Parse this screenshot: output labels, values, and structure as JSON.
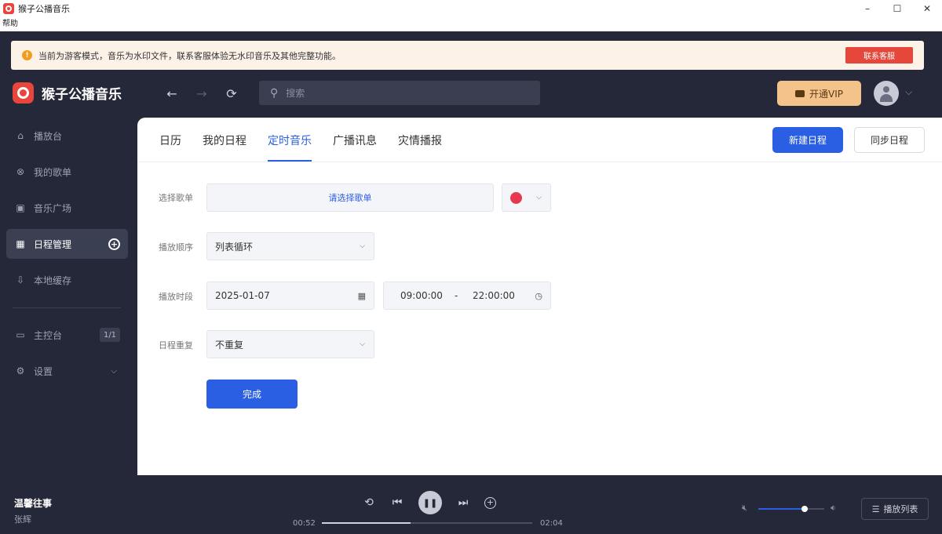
{
  "window": {
    "title": "猴子公播音乐",
    "minimize": "–",
    "maximize": "☐",
    "close": "✕"
  },
  "menubar": {
    "help": "帮助"
  },
  "notice": {
    "text": "当前为游客模式，音乐为水印文件，联系客服体验无水印音乐及其他完整功能。",
    "button": "联系客服",
    "icon": "warning-icon"
  },
  "header": {
    "logo": "猴子公播音乐",
    "back": "←",
    "forward": "→",
    "refresh": "⟳",
    "search_placeholder": "搜索",
    "vip": "开通VIP"
  },
  "sidebar": {
    "items": [
      {
        "label": "播放台",
        "icon": "home-icon",
        "glyph": "⌂"
      },
      {
        "label": "我的歌单",
        "icon": "playlist-icon",
        "glyph": "⊗"
      },
      {
        "label": "音乐广场",
        "icon": "music-square-icon",
        "glyph": "▣"
      },
      {
        "label": "日程管理",
        "icon": "calendar-icon",
        "glyph": "▦"
      },
      {
        "label": "本地缓存",
        "icon": "download-icon",
        "glyph": "⇩"
      },
      {
        "label": "主控台",
        "icon": "monitor-icon",
        "glyph": "▭",
        "badge": "1/1"
      },
      {
        "label": "设置",
        "icon": "gear-icon",
        "glyph": "⚙"
      }
    ]
  },
  "tabs": [
    "日历",
    "我的日程",
    "定时音乐",
    "广播讯息",
    "灾情播报"
  ],
  "active_tab": "定时音乐",
  "actions": {
    "new": "新建日程",
    "sync": "同步日程"
  },
  "form": {
    "playlist_label": "选择歌单",
    "playlist_value": "请选择歌单",
    "color": "#e8384f",
    "order_label": "播放顺序",
    "order_value": "列表循环",
    "period_label": "播放时段",
    "date_value": "2025-01-07",
    "time_start": "09:00:00",
    "time_sep": "-",
    "time_end": "22:00:00",
    "repeat_label": "日程重复",
    "repeat_value": "不重复",
    "submit": "完成"
  },
  "player": {
    "title": "温馨往事",
    "artist": "张辉",
    "current": "00:52",
    "total": "02:04",
    "progress": 0.42,
    "volume": 0.7,
    "playlist_button": "播放列表"
  },
  "colors": {
    "accent": "#2b5fe3",
    "dark": "#252838",
    "vip": "#f4c38c",
    "notice_btn": "#e5473a"
  }
}
